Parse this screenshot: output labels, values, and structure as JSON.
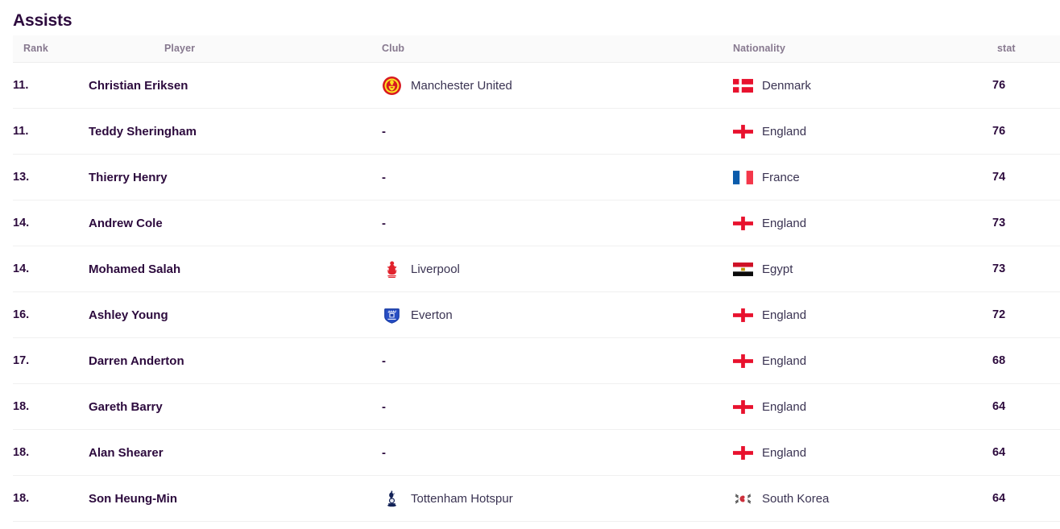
{
  "section": {
    "title": "Assists"
  },
  "table": {
    "columns": [
      {
        "key": "rank",
        "label": "Rank"
      },
      {
        "key": "player",
        "label": "Player"
      },
      {
        "key": "club",
        "label": "Club"
      },
      {
        "key": "nationality",
        "label": "Nationality"
      },
      {
        "key": "stat",
        "label": "stat"
      }
    ],
    "empty_value": "-",
    "rows": [
      {
        "rank": "11.",
        "player": "Christian Eriksen",
        "club": "Manchester United",
        "club_icon": "manchester-united-crest-icon",
        "nationality": "Denmark",
        "flag_icon": "flag-denmark-icon",
        "stat": "76"
      },
      {
        "rank": "11.",
        "player": "Teddy Sheringham",
        "club": "-",
        "club_icon": "",
        "nationality": "England",
        "flag_icon": "flag-england-icon",
        "stat": "76"
      },
      {
        "rank": "13.",
        "player": "Thierry Henry",
        "club": "-",
        "club_icon": "",
        "nationality": "France",
        "flag_icon": "flag-france-icon",
        "stat": "74"
      },
      {
        "rank": "14.",
        "player": "Andrew Cole",
        "club": "-",
        "club_icon": "",
        "nationality": "England",
        "flag_icon": "flag-england-icon",
        "stat": "73"
      },
      {
        "rank": "14.",
        "player": "Mohamed Salah",
        "club": "Liverpool",
        "club_icon": "liverpool-crest-icon",
        "nationality": "Egypt",
        "flag_icon": "flag-egypt-icon",
        "stat": "73"
      },
      {
        "rank": "16.",
        "player": "Ashley Young",
        "club": "Everton",
        "club_icon": "everton-crest-icon",
        "nationality": "England",
        "flag_icon": "flag-england-icon",
        "stat": "72"
      },
      {
        "rank": "17.",
        "player": "Darren Anderton",
        "club": "-",
        "club_icon": "",
        "nationality": "England",
        "flag_icon": "flag-england-icon",
        "stat": "68"
      },
      {
        "rank": "18.",
        "player": "Gareth Barry",
        "club": "-",
        "club_icon": "",
        "nationality": "England",
        "flag_icon": "flag-england-icon",
        "stat": "64"
      },
      {
        "rank": "18.",
        "player": "Alan Shearer",
        "club": "-",
        "club_icon": "",
        "nationality": "England",
        "flag_icon": "flag-england-icon",
        "stat": "64"
      },
      {
        "rank": "18.",
        "player": "Son Heung-Min",
        "club": "Tottenham Hotspur",
        "club_icon": "tottenham-hotspur-crest-icon",
        "nationality": "South Korea",
        "flag_icon": "flag-south-korea-icon",
        "stat": "64"
      }
    ]
  },
  "colors": {
    "title_text": "#2c0a3d",
    "header_text": "#87798f",
    "header_bg": "#fafafa",
    "body_text": "#3a3352",
    "row_border": "#f0f0f0",
    "page_bg": "#ffffff"
  }
}
